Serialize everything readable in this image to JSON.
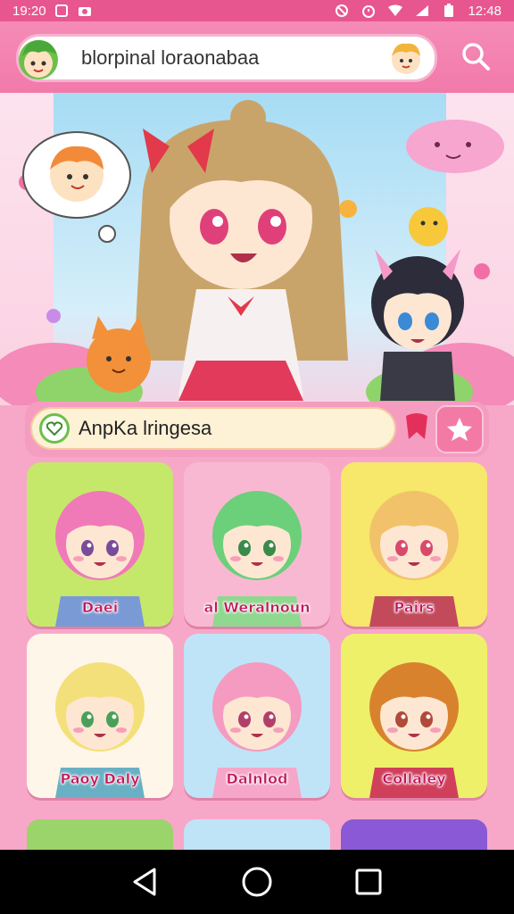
{
  "status_bar": {
    "time_left": "19:20",
    "time_right": "12:48"
  },
  "search": {
    "query": "blorpinal loraonabaa"
  },
  "section": {
    "title": "AnpKa lringesa"
  },
  "cards": [
    {
      "label": "Daei",
      "bg": "#c6e86a",
      "hair": "#f07ab8",
      "eye": "#7a4b9a",
      "shirt": "#7a9ad6"
    },
    {
      "label": "al Weralnoun",
      "bg": "#f8b8d2",
      "hair": "#6ccf7a",
      "eye": "#3a8a4a",
      "shirt": "#8fd88f"
    },
    {
      "label": "Pairs",
      "bg": "#f7e76a",
      "hair": "#f2c26a",
      "eye": "#d84a6a",
      "shirt": "#c24a5a"
    },
    {
      "label": "Paoy Daly",
      "bg": "#fff6ea",
      "hair": "#f4e07a",
      "eye": "#4aa05a",
      "shirt": "#6ab0c4"
    },
    {
      "label": "Dalnlod",
      "bg": "#bfe4f7",
      "hair": "#f59ac0",
      "eye": "#b0406a",
      "shirt": "#f6a6c8"
    },
    {
      "label": "Collaley",
      "bg": "#eef06a",
      "hair": "#d9822e",
      "eye": "#b04a3a",
      "shirt": "#d0405a"
    }
  ],
  "colors": {
    "accent": "#e8568f",
    "header": "#f27aaa",
    "page_bg": "#f7a8c8"
  },
  "icons": {
    "search": "search-icon",
    "favorite": "star-icon",
    "section": "heart-icon",
    "nav_back": "back-triangle-icon",
    "nav_home": "home-circle-icon",
    "nav_recents": "recents-square-icon"
  }
}
